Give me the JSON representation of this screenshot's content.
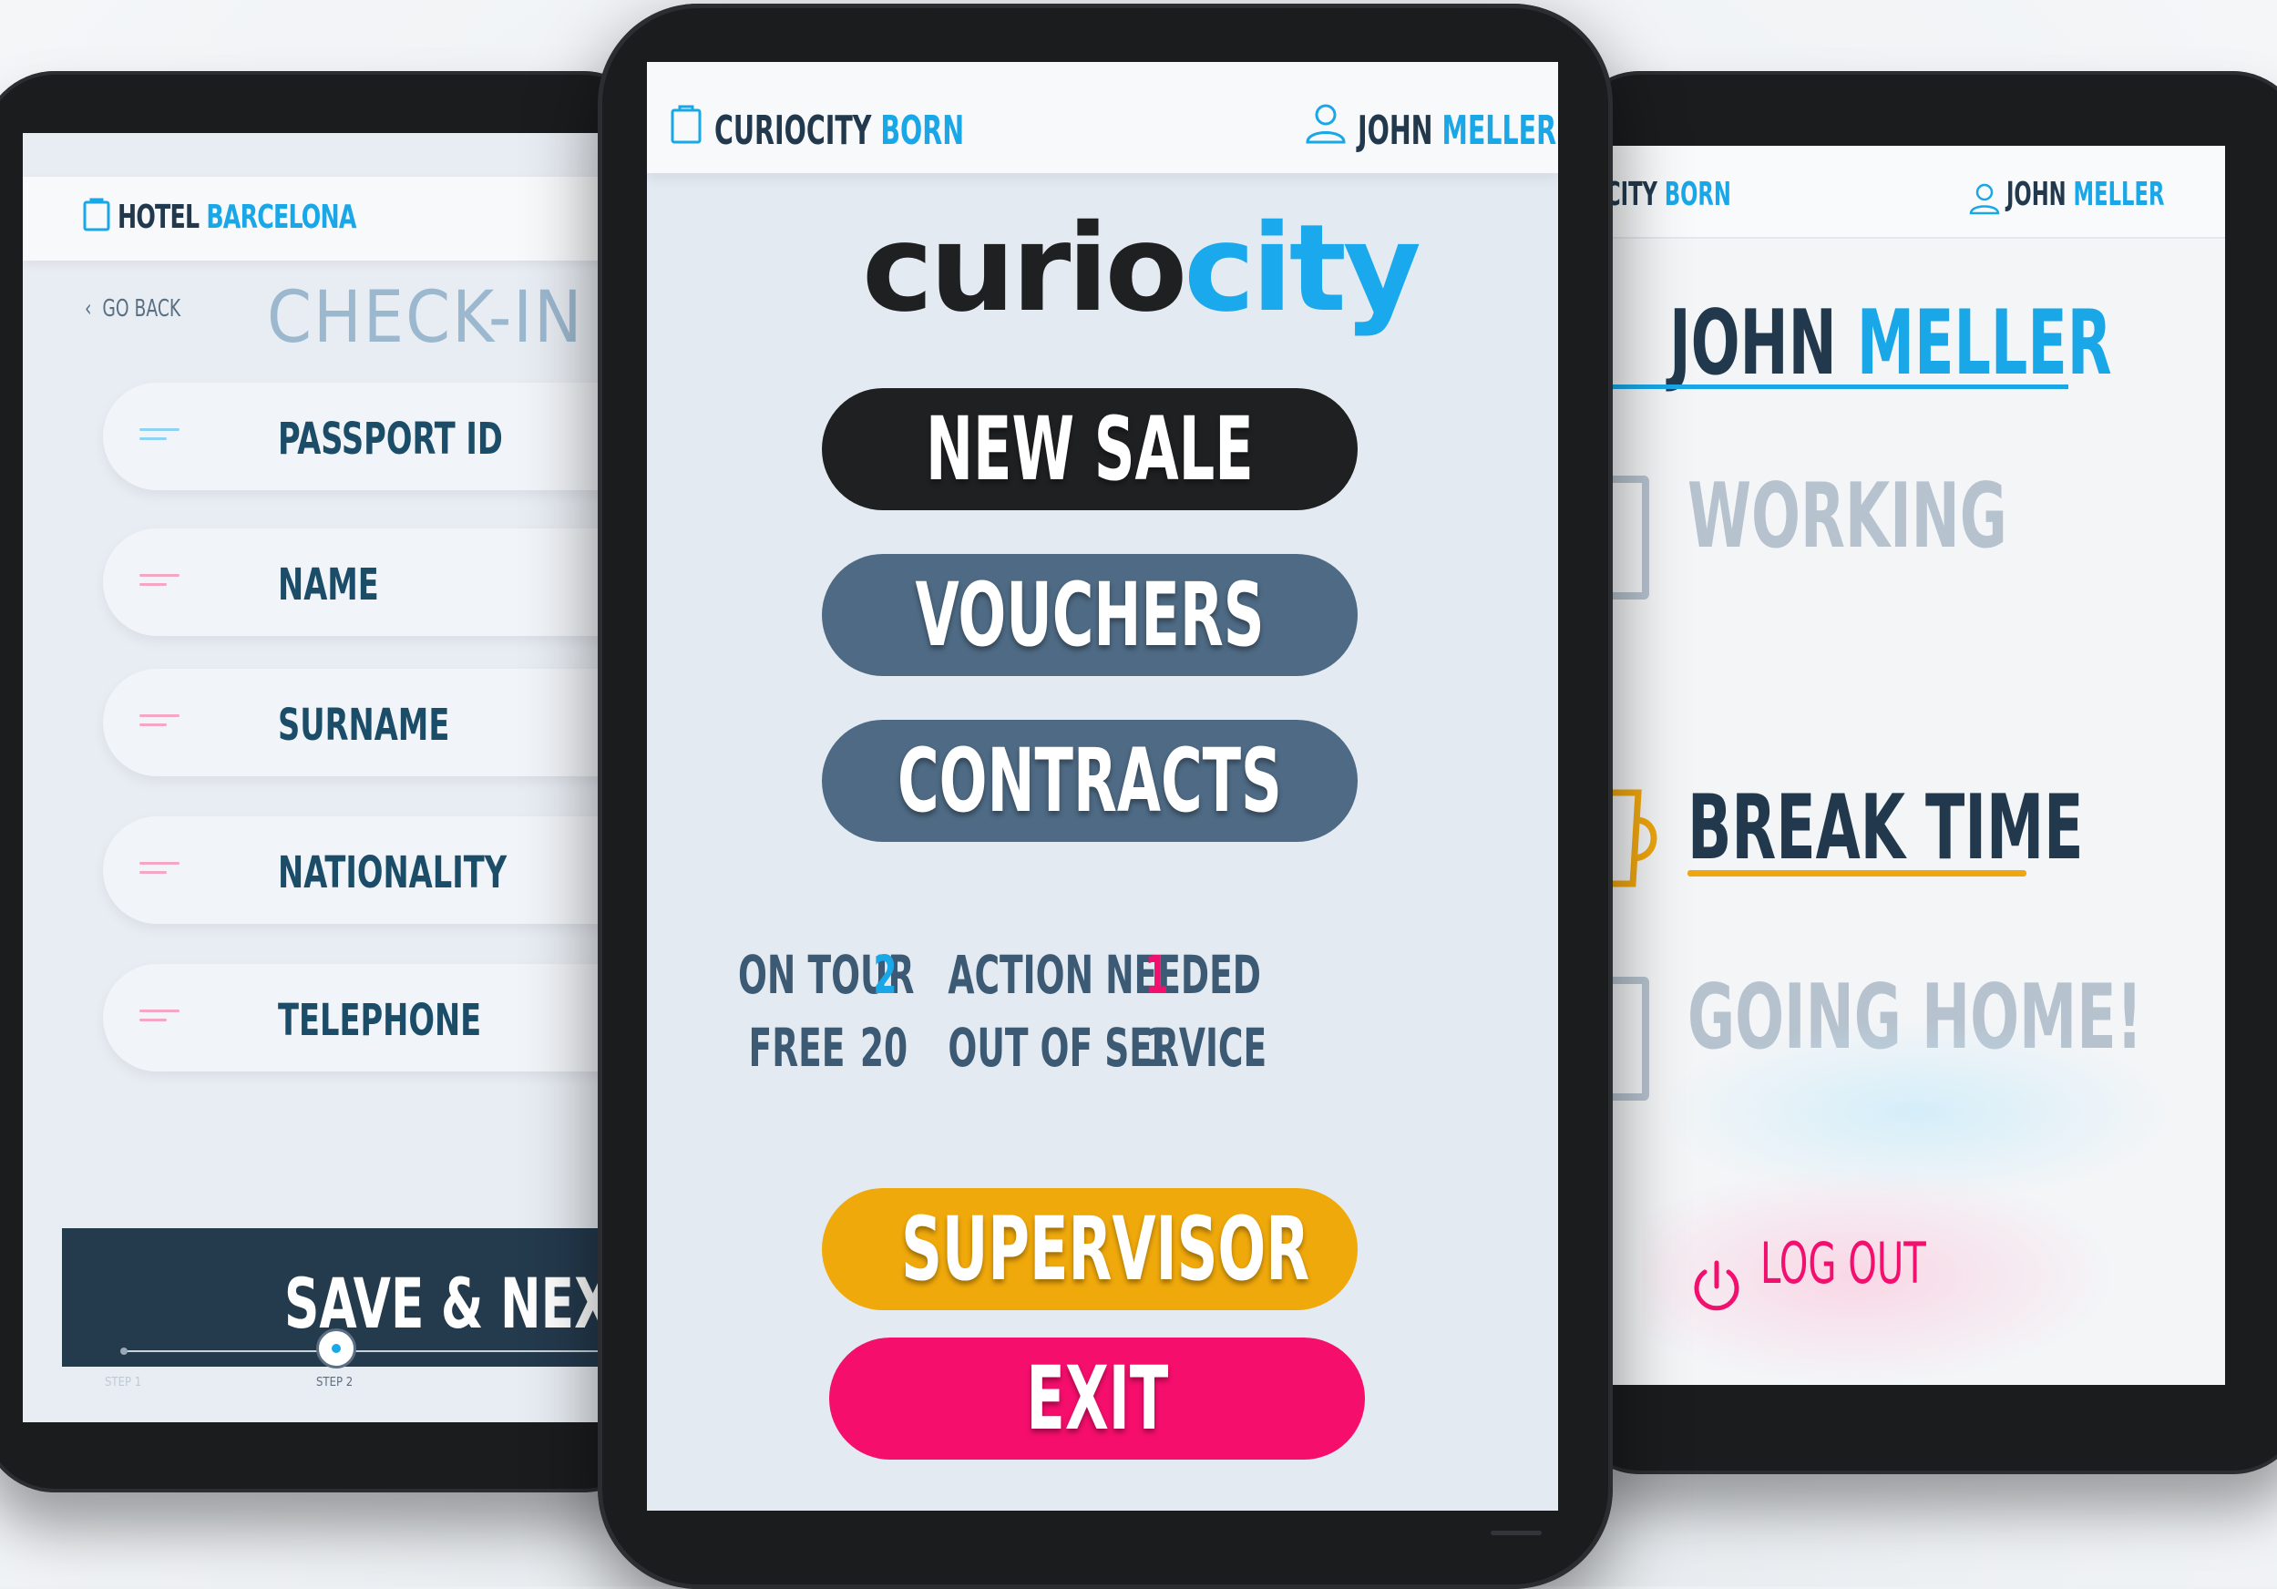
{
  "left_tablet": {
    "header": {
      "brand_a": "HOTEL",
      "brand_b": "BARCELONA"
    },
    "back_label": "GO BACK",
    "title": "CHECK-IN",
    "fields": [
      {
        "label": "PASSPORT ID",
        "accent": "#8fd3f4"
      },
      {
        "label": "NAME",
        "accent": "#f5a6c2"
      },
      {
        "label": "SURNAME",
        "accent": "#f5a6c2"
      },
      {
        "label": "NATIONALITY",
        "accent": "#f5a6c2"
      },
      {
        "label": "TELEPHONE",
        "accent": "#f5a6c2"
      }
    ],
    "save_label": "SAVE & NEXT",
    "steps": [
      {
        "label": "STEP 1"
      },
      {
        "label": "STEP 2"
      }
    ]
  },
  "center_tablet": {
    "header": {
      "brand_a": "CURIOCITY",
      "brand_b": "BORN",
      "user_first": "JOHN",
      "user_last": "MELLER"
    },
    "logo": {
      "part1": "curio",
      "part2": "city"
    },
    "buttons": {
      "new_sale": "NEW SALE",
      "vouchers": "VOUCHERS",
      "contracts": "CONTRACTS",
      "supervisor": "SUPERVISOR",
      "exit": "EXIT"
    },
    "stats": {
      "on_tour_label": "ON TOUR",
      "on_tour_value": "2",
      "free_label": "FREE",
      "free_value": "20",
      "action_needed_label": "ACTION NEEDED",
      "action_needed_value": "1",
      "out_of_service_label": "OUT OF SERVICE",
      "out_of_service_value": "1"
    },
    "colors": {
      "new_sale": "#1f2022",
      "vouchers": "#4e6a84",
      "contracts": "#4e6a84",
      "supervisor": "#f0a90b",
      "exit": "#f50e6c",
      "accent": "#1aa7e8"
    }
  },
  "right_tablet": {
    "header": {
      "brand_a": "CITY",
      "brand_b": "BORN",
      "user_first": "JOHN",
      "user_last": "MELLER"
    },
    "name_first": "JOHN",
    "name_last": "MELLER",
    "statuses": {
      "working": "WORKING",
      "break_time": "BREAK TIME",
      "going_home": "GOING HOME!"
    },
    "logout_label": "LOG OUT"
  }
}
